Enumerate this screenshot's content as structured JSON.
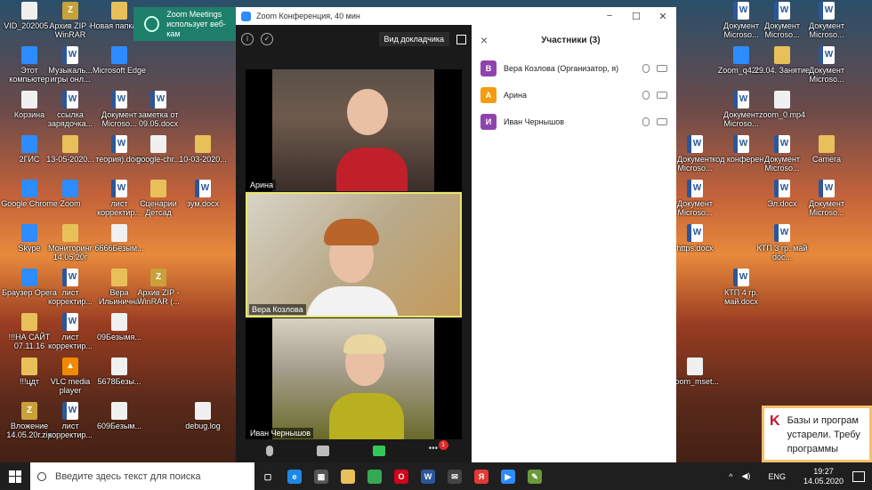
{
  "desktop": {
    "icons": [
      {
        "label": "VID_202005...",
        "kind": "file",
        "col": 0,
        "row": 0
      },
      {
        "label": "Архив ZIP - WinRAR",
        "kind": "zip",
        "col": 1,
        "row": 0
      },
      {
        "label": "Новая папка (2)",
        "kind": "folder",
        "col": 2,
        "row": 0
      },
      {
        "label": "Этот компьютер",
        "kind": "app",
        "col": 0,
        "row": 1
      },
      {
        "label": "Музыкаль... игры онл...",
        "kind": "doc",
        "col": 1,
        "row": 1
      },
      {
        "label": "Microsoft Edge",
        "kind": "app",
        "col": 2,
        "row": 1
      },
      {
        "label": "Корзина",
        "kind": "file",
        "col": 0,
        "row": 2
      },
      {
        "label": "ссылка зарядочка...",
        "kind": "doc",
        "col": 1,
        "row": 2
      },
      {
        "label": "Документ Microso...",
        "kind": "doc",
        "col": 2,
        "row": 2
      },
      {
        "label": "заметка от 09.05.docx",
        "kind": "doc",
        "col": 3,
        "row": 2
      },
      {
        "label": "2ГИС",
        "kind": "app",
        "col": 0,
        "row": 3
      },
      {
        "label": "13-05-2020...",
        "kind": "folder",
        "col": 1,
        "row": 3
      },
      {
        "label": "теория).docx",
        "kind": "doc",
        "col": 2,
        "row": 3
      },
      {
        "label": "google-chr...",
        "kind": "file",
        "col": 3,
        "row": 3
      },
      {
        "label": "10-03-2020...",
        "kind": "folder",
        "col": 4,
        "row": 3
      },
      {
        "label": "Google Chrome",
        "kind": "app",
        "col": 0,
        "row": 4
      },
      {
        "label": "Zoom",
        "kind": "app",
        "col": 1,
        "row": 4
      },
      {
        "label": "лист корректир...",
        "kind": "doc",
        "col": 2,
        "row": 4
      },
      {
        "label": "Сценарии Детсад",
        "kind": "folder",
        "col": 3,
        "row": 4
      },
      {
        "label": "зум.docx",
        "kind": "doc",
        "col": 4,
        "row": 4
      },
      {
        "label": "Skype",
        "kind": "app",
        "col": 0,
        "row": 5
      },
      {
        "label": "Мониторинг 14.05.20г",
        "kind": "folder",
        "col": 1,
        "row": 5
      },
      {
        "label": "6666Безым...",
        "kind": "file",
        "col": 2,
        "row": 5
      },
      {
        "label": "Браузер Opera",
        "kind": "app",
        "col": 0,
        "row": 6
      },
      {
        "label": "лист корректир...",
        "kind": "doc",
        "col": 1,
        "row": 6
      },
      {
        "label": "Вера Ильинична",
        "kind": "folder",
        "col": 2,
        "row": 6
      },
      {
        "label": "Архив ZIP - WinRAR (...",
        "kind": "zip",
        "col": 3,
        "row": 6
      },
      {
        "label": "!!!НА САЙТ 07.11.16",
        "kind": "folder",
        "col": 0,
        "row": 7
      },
      {
        "label": "лист корректир...",
        "kind": "doc",
        "col": 1,
        "row": 7
      },
      {
        "label": "09Безымя...",
        "kind": "file",
        "col": 2,
        "row": 7
      },
      {
        "label": "!!!цдт",
        "kind": "folder",
        "col": 0,
        "row": 8
      },
      {
        "label": "VLC media player",
        "kind": "vlc",
        "col": 1,
        "row": 8
      },
      {
        "label": "5678Безы...",
        "kind": "file",
        "col": 2,
        "row": 8
      },
      {
        "label": "Вложение 14.05.20г.zip",
        "kind": "zip",
        "col": 0,
        "row": 9
      },
      {
        "label": "лист корректир...",
        "kind": "doc",
        "col": 1,
        "row": 9
      },
      {
        "label": "609Безым...",
        "kind": "file",
        "col": 2,
        "row": 9
      },
      {
        "label": "debug.log",
        "kind": "file",
        "col": 4,
        "row": 9
      },
      {
        "label": "Документ Microso...",
        "kind": "doc",
        "col": 12,
        "row": 0
      },
      {
        "label": "Документ Microso...",
        "kind": "doc",
        "col": 13,
        "row": 0
      },
      {
        "label": "Документ Microso...",
        "kind": "doc",
        "col": 14,
        "row": 0
      },
      {
        "label": "Zoom_q42l...",
        "kind": "app",
        "col": 12,
        "row": 1
      },
      {
        "label": "29.04. Занятие",
        "kind": "folder",
        "col": 13,
        "row": 1
      },
      {
        "label": "Документ Microso...",
        "kind": "doc",
        "col": 14,
        "row": 1
      },
      {
        "label": "Документ Microso...",
        "kind": "doc",
        "col": 12,
        "row": 2
      },
      {
        "label": "zoom_0.mp4",
        "kind": "file",
        "col": 13,
        "row": 2
      },
      {
        "label": "Документ Microso...",
        "kind": "doc",
        "col": 11,
        "row": 3
      },
      {
        "label": "код конферен...",
        "kind": "doc",
        "col": 12,
        "row": 3
      },
      {
        "label": "Документ Microso...",
        "kind": "doc",
        "col": 13,
        "row": 3
      },
      {
        "label": "Camera",
        "kind": "folder",
        "col": 14,
        "row": 3
      },
      {
        "label": "Документ Microso...",
        "kind": "doc",
        "col": 11,
        "row": 4
      },
      {
        "label": "Эл.docx",
        "kind": "doc",
        "col": 13,
        "row": 4
      },
      {
        "label": "Документ Microso...",
        "kind": "doc",
        "col": 14,
        "row": 4
      },
      {
        "label": "https.docx",
        "kind": "doc",
        "col": 11,
        "row": 5
      },
      {
        "label": "КТП 3 гр. май doc...",
        "kind": "doc",
        "col": 13,
        "row": 5
      },
      {
        "label": "КТП 4 гр. май.docx",
        "kind": "doc",
        "col": 12,
        "row": 6
      },
      {
        "label": "zoom_mset...",
        "kind": "file",
        "col": 11,
        "row": 8
      }
    ]
  },
  "notification": {
    "title": "Zoom Meetings",
    "text": "использует веб-кам"
  },
  "zoom": {
    "title": "Zoom Конференция, 40 мин",
    "view_label": "Вид докладчика",
    "videos": [
      {
        "name": "Арина"
      },
      {
        "name": "Вера Козлова"
      },
      {
        "name": "Иван Чернышов"
      }
    ],
    "chat_badge": "1",
    "participants_title": "Участники (3)",
    "participants": [
      {
        "initial": "В",
        "name": "Вера Козлова (Организатор, я)",
        "color": "#8e44ad"
      },
      {
        "initial": "А",
        "name": "Арина",
        "color": "#f39c12"
      },
      {
        "initial": "И",
        "name": "Иван Чернышов",
        "color": "#8e44ad"
      }
    ]
  },
  "kaspersky": {
    "text": "Базы и програм устарели. Требу программы"
  },
  "taskbar": {
    "search_placeholder": "Введите здесь текст для поиска",
    "lang": "ENG",
    "time": "19:27",
    "date": "14.05.2020",
    "apps": [
      {
        "name": "task-view-icon",
        "glyph": "▢",
        "color": "#1f1f1f"
      },
      {
        "name": "edge-icon",
        "glyph": "e",
        "color": "#1e88e5"
      },
      {
        "name": "calculator-icon",
        "glyph": "▦",
        "color": "#555"
      },
      {
        "name": "explorer-icon",
        "glyph": "",
        "color": "#e8c05a"
      },
      {
        "name": "chrome-icon",
        "glyph": "",
        "color": "#34a853"
      },
      {
        "name": "opera-icon",
        "glyph": "O",
        "color": "#d0021b"
      },
      {
        "name": "word-icon",
        "glyph": "W",
        "color": "#2b579a"
      },
      {
        "name": "mail-icon",
        "glyph": "✉",
        "color": "#444"
      },
      {
        "name": "yandex-icon",
        "glyph": "Я",
        "color": "#e53935"
      },
      {
        "name": "zoom-icon",
        "glyph": "▶",
        "color": "#2d8cff"
      },
      {
        "name": "paint-icon",
        "glyph": "✎",
        "color": "#6a9a3a"
      }
    ]
  }
}
